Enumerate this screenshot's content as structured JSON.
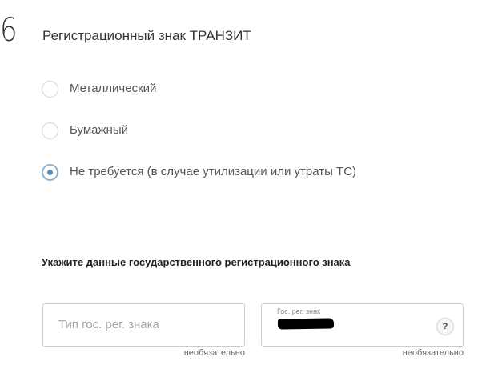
{
  "section": {
    "number": "6",
    "title": "Регистрационный знак ТРАНЗИТ"
  },
  "plate_options": {
    "selected_index": 2,
    "items": [
      {
        "label": "Металлический",
        "checked": false
      },
      {
        "label": "Бумажный",
        "checked": false
      },
      {
        "label": "Не требуется (в случае утилизации или утраты ТС)",
        "checked": true
      }
    ]
  },
  "plate_details": {
    "heading": "Укажите данные государственного регистрационного знака",
    "type_field": {
      "placeholder": "Тип гос. рег. знака",
      "note": "необязательно"
    },
    "number_field": {
      "label": "Гос. рег. знак",
      "value_redacted": true,
      "help_glyph": "?",
      "note": "необязательно"
    }
  },
  "colors": {
    "accent": "#5b8fb9",
    "border": "#c9cdd2",
    "text": "#333333",
    "placeholder": "#a3a7ab"
  }
}
